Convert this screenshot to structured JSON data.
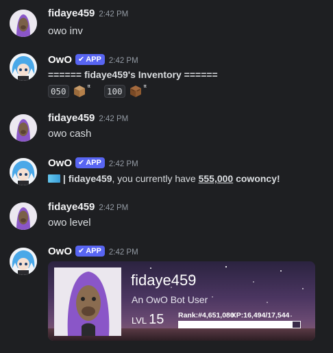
{
  "messages": [
    {
      "author": "fidaye459",
      "time": "2:42 PM",
      "text": "owo inv"
    },
    {
      "author": "OwO",
      "badge": "APP",
      "time": "2:42 PM",
      "title": "====== fidaye459's Inventory ======",
      "items": [
        {
          "code": "050",
          "sup": "ᵗᵗ"
        },
        {
          "code": "100",
          "sup": "ᵗᵗ"
        }
      ]
    },
    {
      "author": "fidaye459",
      "time": "2:42 PM",
      "text": "owo cash"
    },
    {
      "author": "OwO",
      "badge": "APP",
      "time": "2:42 PM",
      "cash": {
        "name": "fidaye459",
        "pre": ", you currently have ",
        "amount": "555,000",
        "post": " cowoncy!"
      }
    },
    {
      "author": "fidaye459",
      "time": "2:42 PM",
      "text": "owo level"
    },
    {
      "author": "OwO",
      "badge": "APP",
      "time": "2:42 PM",
      "card": {
        "username": "fidaye459",
        "subtitle": "An OwO Bot User",
        "lvl_label": "LVL",
        "level": "15",
        "rank": "Rank:#4,651,086",
        "xp": "XP:16,494/17,544",
        "xp_fraction": 0.94
      }
    }
  ],
  "colors": {
    "background": "#1e1f22",
    "badge": "#5865f2",
    "text": "#dbdee1"
  }
}
